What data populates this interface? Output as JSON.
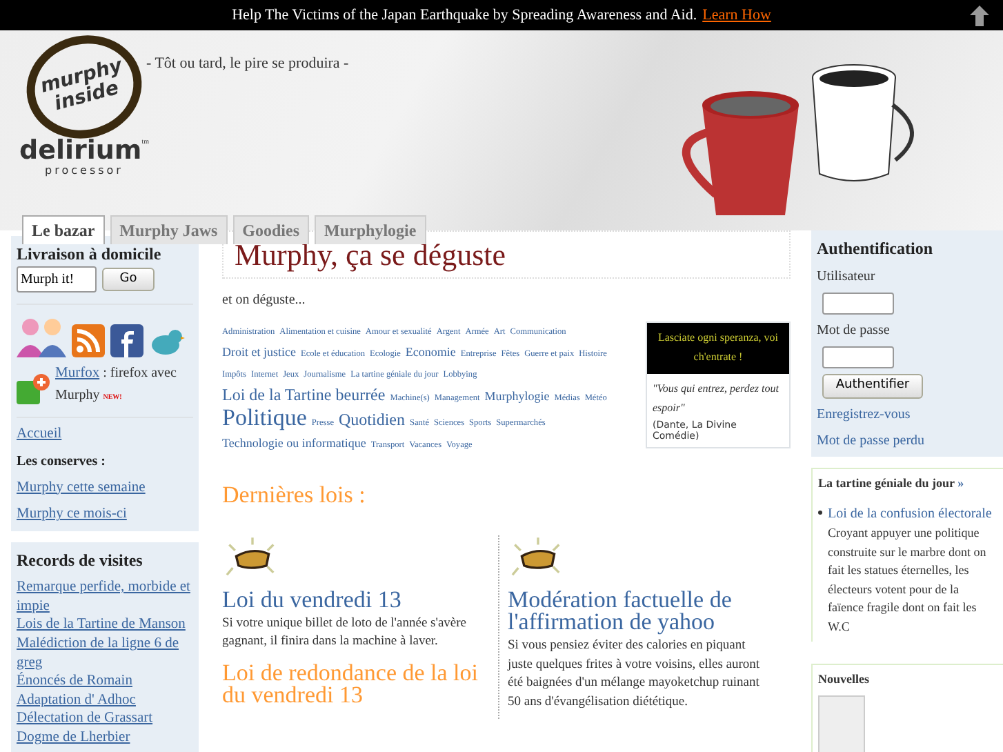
{
  "top_banner": {
    "text": "Help The Victims of the Japan Earthquake by Spreading Awareness and Aid.",
    "link": "Learn How"
  },
  "header": {
    "logo_ring": "murphy inside",
    "logo_word": "delirium",
    "logo_tm": "tm",
    "logo_sub": "processor",
    "tagline": "- Tôt ou tard, le pire se produira -"
  },
  "tabs": [
    {
      "label": "Le bazar",
      "selected": true
    },
    {
      "label": "Murphy Jaws",
      "selected": false
    },
    {
      "label": "Goodies",
      "selected": false
    },
    {
      "label": "Murphylogie",
      "selected": false
    }
  ],
  "left_sidebar": {
    "search": {
      "title": "Livraison à domicile",
      "value": "Murph it!",
      "button": "Go"
    },
    "addon": {
      "link": "Murfox",
      "text": " : firefox avec Murphy",
      "badge": "NEW!"
    },
    "links": [
      {
        "kind": "link",
        "label": "Accueil"
      },
      {
        "kind": "heading",
        "label": "Les conserves :"
      },
      {
        "kind": "link",
        "label": "Murphy cette semaine"
      },
      {
        "kind": "link",
        "label": "Murphy ce mois-ci"
      }
    ],
    "records": {
      "title": "Records de visites",
      "items": [
        "Remarque perfide, morbide et impie",
        "Lois de la Tartine de Manson",
        "Malédiction de la ligne 6 de greg",
        "Énoncés de Romain",
        "Adaptation d' Adhoc",
        "Délectation de Grassart",
        "Dogme de Lherbier"
      ]
    }
  },
  "main": {
    "title": "Murphy, ça se déguste",
    "subtitle": "et on déguste...",
    "tags": [
      {
        "label": "Administration",
        "kind": "s"
      },
      {
        "label": "Alimentation et cuisine",
        "kind": "s"
      },
      {
        "label": "Amour et sexualité",
        "kind": "s"
      },
      {
        "label": "Argent",
        "kind": "s"
      },
      {
        "label": "Armée",
        "kind": "s"
      },
      {
        "label": "Art",
        "kind": "s"
      },
      {
        "label": "Communication",
        "kind": "s"
      },
      {
        "label": "Droit et justice",
        "kind": "m"
      },
      {
        "label": "Ecole et éducation",
        "kind": "s"
      },
      {
        "label": "Ecologie",
        "kind": "s"
      },
      {
        "label": "Economie",
        "kind": "m"
      },
      {
        "label": "Entreprise",
        "kind": "s"
      },
      {
        "label": "Fêtes",
        "kind": "s"
      },
      {
        "label": "Guerre et paix",
        "kind": "s"
      },
      {
        "label": "Histoire",
        "kind": "s"
      },
      {
        "label": "Impôts",
        "kind": "s"
      },
      {
        "label": "Internet",
        "kind": "s"
      },
      {
        "label": "Jeux",
        "kind": "s"
      },
      {
        "label": "Journalisme",
        "kind": "s"
      },
      {
        "label": "La tartine géniale du jour",
        "kind": "s"
      },
      {
        "label": "Lobbying",
        "kind": "s"
      },
      {
        "label": "Loi de la Tartine beurrée",
        "kind": "l"
      },
      {
        "label": "Machine(s)",
        "kind": "s"
      },
      {
        "label": "Management",
        "kind": "s"
      },
      {
        "label": "Murphylogie",
        "kind": "m"
      },
      {
        "label": "Médias",
        "kind": "s"
      },
      {
        "label": "Météo",
        "kind": "s"
      },
      {
        "label": "Politique",
        "kind": "xl"
      },
      {
        "label": "Presse",
        "kind": "s"
      },
      {
        "label": "Quotidien",
        "kind": "l"
      },
      {
        "label": "Santé",
        "kind": "s"
      },
      {
        "label": "Sciences",
        "kind": "s"
      },
      {
        "label": "Sports",
        "kind": "s"
      },
      {
        "label": "Supermarchés",
        "kind": "s"
      },
      {
        "label": "Technologie ou informatique",
        "kind": "m"
      },
      {
        "label": "Transport",
        "kind": "s"
      },
      {
        "label": "Vacances",
        "kind": "s"
      },
      {
        "label": "Voyage",
        "kind": "s"
      }
    ],
    "quote": {
      "header": "Lasciate ogni speranza, voi ch'entrate !",
      "text": "\"Vous qui entrez, perdez tout espoir\"",
      "source": "(Dante, La Divine Comédie)"
    },
    "latest_title": "Dernières lois :",
    "columns": [
      [
        {
          "title": "Loi du vendredi 13",
          "kind": "main",
          "text": "Si votre unique billet de loto de l'année s'avère gagnant, il finira dans la machine à laver."
        },
        {
          "title": "Loi de redondance de la loi du vendredi 13",
          "kind": "alt"
        }
      ],
      [
        {
          "title": "Modération factuelle de l'affirmation de yahoo",
          "kind": "main",
          "text": "Si vous pensiez éviter des calories en piquant juste quelques frites à votre voisins, elles auront été baignées d'un mélange mayoketchup ruinant 50 ans d'évangélisation diététique."
        }
      ]
    ]
  },
  "right_sidebar": {
    "auth": {
      "title": "Authentification",
      "user_label": "Utilisateur",
      "pass_label": "Mot de passe",
      "button": "Authentifier",
      "links": [
        "Enregistrez-vous",
        "Mot de passe perdu"
      ]
    },
    "daily": {
      "title": "La tartine géniale du jour",
      "more": "»",
      "item_link": "Loi de la confusion électorale",
      "item_text": "Croyant appuyer une politique construite sur le marbre dont on fait les statues éternelles, les électeurs votent pour de la faïence fragile dont on fait les W.C"
    },
    "news": {
      "title": "Nouvelles"
    }
  }
}
